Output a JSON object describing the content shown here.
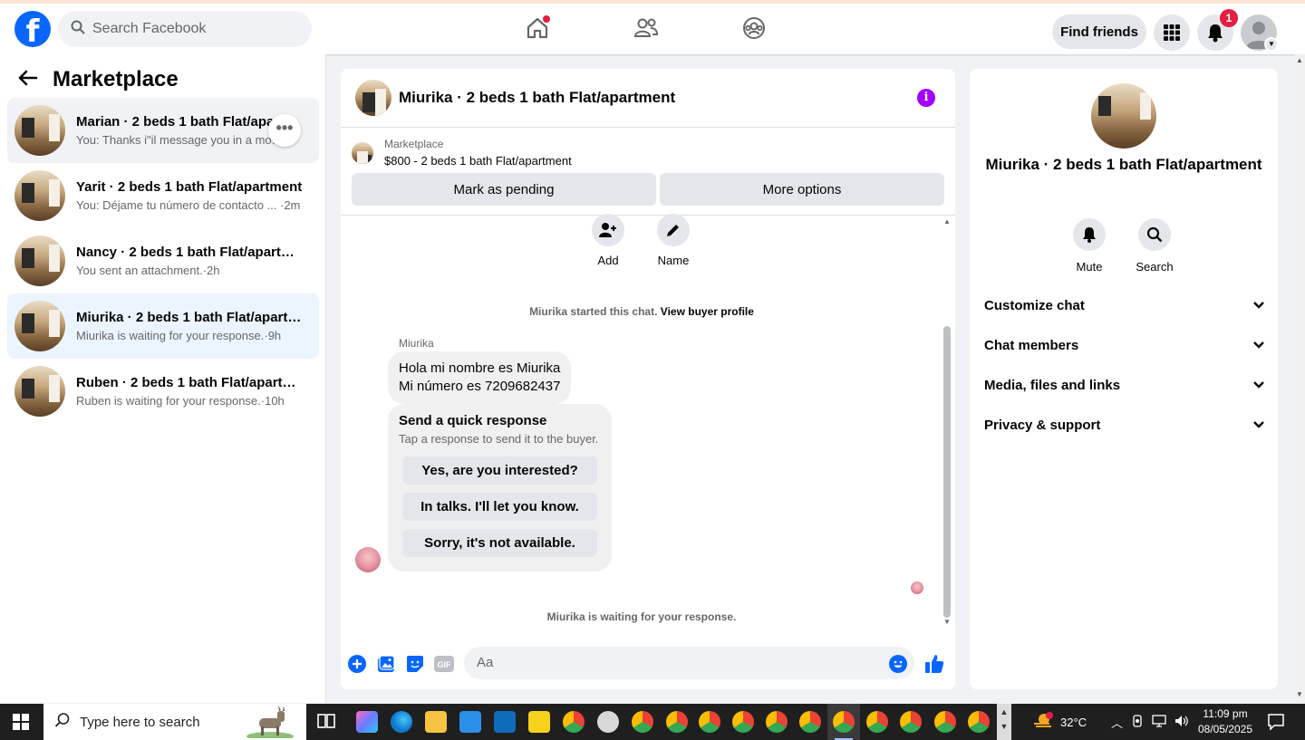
{
  "topbar": {
    "logo_letter": "f",
    "search_placeholder": "Search Facebook",
    "find_friends": "Find friends",
    "notification_count": "1"
  },
  "sidebar": {
    "title": "Marketplace",
    "conversations": [
      {
        "name": "Marian · 2 beds 1 bath Flat/apa…",
        "preview": "You: Thanks i\"il message you in a mo…m"
      },
      {
        "name": "Yarit · 2 beds 1 bath Flat/apartment",
        "preview": "You: Déjame tu número de contacto ... ·2m"
      },
      {
        "name": "Nancy · 2 beds 1 bath Flat/apartm…",
        "preview": "You sent an attachment.·2h"
      },
      {
        "name": "Miurika · 2 beds 1 bath Flat/apart…",
        "preview": "Miurika is waiting for your response.·9h"
      },
      {
        "name": "Ruben · 2 beds 1 bath Flat/apartm…",
        "preview": "Ruben is waiting for your response.·10h"
      }
    ],
    "more_dots": "•••"
  },
  "chat": {
    "title": "Miurika · 2 beds 1 bath Flat/apartment",
    "listing_source": "Marketplace",
    "listing_price": "$800 - 2 beds 1 bath Flat/apartment",
    "btn_pending": "Mark as pending",
    "btn_more": "More options",
    "action_add": "Add",
    "action_name": "Name",
    "started_text": "Miurika started this chat.",
    "view_profile": "View buyer profile",
    "sender": "Miurika",
    "message_line1": "Hola mi nombre es Miurika",
    "message_line2": "Mi número es 7209682437",
    "quick_title": "Send a quick response",
    "quick_sub": "Tap a response to send it to the buyer.",
    "quick_responses": [
      "Yes, are you interested?",
      "In talks. I'll let you know.",
      "Sorry, it's not available."
    ],
    "waiting": "Miurika is waiting for your response.",
    "composer_placeholder": "Aa"
  },
  "info_panel": {
    "title": "Miurika · 2 beds 1 bath Flat/apartment",
    "mute": "Mute",
    "search": "Search",
    "sections": [
      "Customize chat",
      "Chat members",
      "Media, files and links",
      "Privacy & support"
    ]
  },
  "taskbar": {
    "search_placeholder": "Type here to search",
    "weather": "32°C",
    "time": "11:09 pm",
    "date": "08/05/2025"
  },
  "colors": {
    "brand_blue": "#0866ff",
    "accent_purple": "#a200ff",
    "notification_red": "#e41e3f"
  }
}
